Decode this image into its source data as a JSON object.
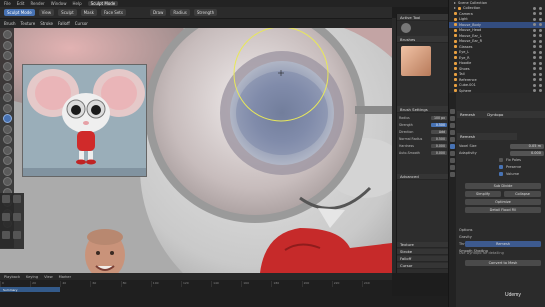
{
  "topbar": {
    "items": [
      "File",
      "Edit",
      "Render",
      "Window",
      "Help",
      "Sculpt Mode"
    ]
  },
  "header": {
    "mode": "Sculpt Mode",
    "chips": [
      "View",
      "Sculpt",
      "Mask",
      "Face Sets"
    ],
    "brush_chips": [
      "Draw",
      "Radius",
      "Strength"
    ]
  },
  "header3": {
    "items": [
      "Brush",
      "Texture",
      "Stroke",
      "Falloff",
      "Cursor"
    ]
  },
  "sidebar": {
    "active_tool": "Active Tool",
    "brushes": "Brushes",
    "brush_settings": "Brush Settings",
    "rows": [
      {
        "label": "Radius",
        "value": "100 px"
      },
      {
        "label": "Strength",
        "value": "0.500"
      },
      {
        "label": "Direction",
        "value": "Add"
      },
      {
        "label": "Normal Radius",
        "value": "0.500"
      },
      {
        "label": "Hardness",
        "value": "0.000"
      },
      {
        "label": "Auto-Smooth",
        "value": "0.000"
      }
    ],
    "sections": [
      "Advanced",
      "Texture",
      "Stroke",
      "Falloff",
      "Cursor",
      "Symmetry",
      "Options"
    ]
  },
  "outliner": {
    "rows": [
      "Scene Collection",
      "Collection",
      "Camera",
      "Light",
      "Mouse_Body",
      "Mouse_Head",
      "Mouse_Ear_L",
      "Mouse_Ear_R",
      "Glasses",
      "Eye_L",
      "Eye_R",
      "Hoodie",
      "Shoes",
      "Tail",
      "Reference",
      "Cube.001",
      "Sphere"
    ]
  },
  "properties": {
    "tabs_count": 10,
    "header_items": [
      "Remesh",
      "Dyntopo",
      "Symmetry"
    ],
    "remesh_label": "Remesh",
    "voxel_size_label": "Voxel Size",
    "voxel_size": "0.05 m",
    "adaptivity_label": "Adaptivity",
    "adaptivity": "0.000",
    "fix_poles": "Fix Poles",
    "preserve": "Preserve",
    "volume": "Volume",
    "remesh_button": "Remesh",
    "buttons": [
      "Sub Divide",
      "Simplify",
      "Collapse",
      "Optimize",
      "Detail Flood Fill"
    ],
    "options": [
      "Options",
      "Gravity",
      "Threaded Sculpt",
      "Smooth Shading"
    ],
    "bottom_button": "Convert to Mesh",
    "note": "Use Dyntopo for detailing"
  },
  "timeline": {
    "items": [
      "Playback",
      "Keying",
      "View",
      "Marker"
    ],
    "ticks": [
      "0",
      "20",
      "40",
      "60",
      "80",
      "100",
      "120",
      "140",
      "160",
      "180",
      "200",
      "220",
      "240"
    ],
    "summary": "Summary"
  },
  "watermark": "Udemy",
  "colors": {
    "accent": "#4772b3",
    "viewport_bg": "#b0b0b0",
    "panel_bg": "#2b2b2b",
    "hoodie_red": "#c62a2a"
  }
}
